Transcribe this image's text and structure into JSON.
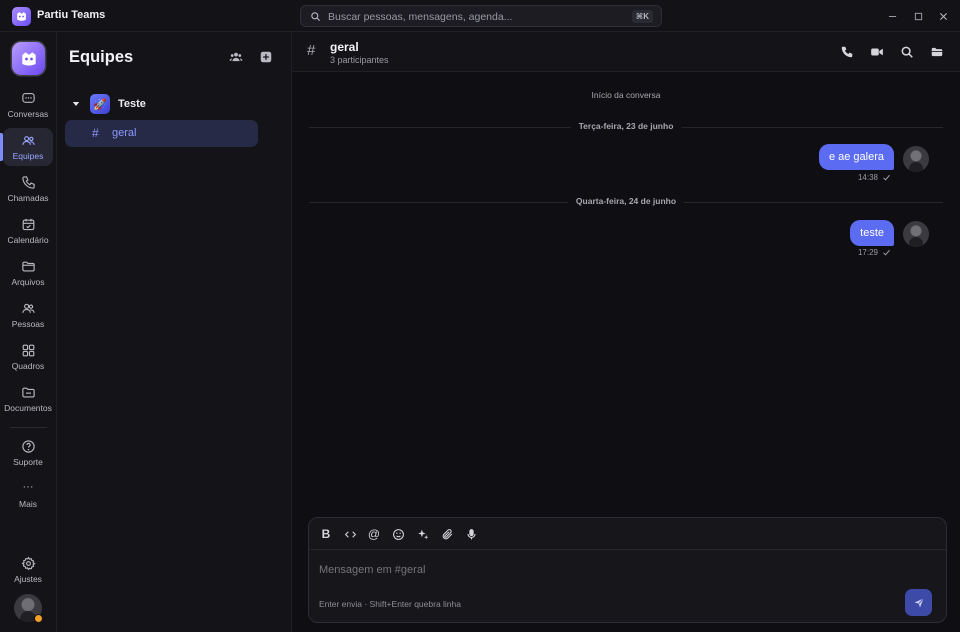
{
  "app": {
    "title": "Partiu Teams"
  },
  "search": {
    "placeholder": "Buscar pessoas, mensagens, agenda...",
    "shortcut": "⌘K"
  },
  "rail": {
    "items": [
      {
        "label": "Conversas",
        "icon": "chat-icon"
      },
      {
        "label": "Equipes",
        "icon": "team-icon",
        "active": true
      },
      {
        "label": "Chamadas",
        "icon": "phone-icon"
      },
      {
        "label": "Calendário",
        "icon": "calendar-icon"
      },
      {
        "label": "Arquivos",
        "icon": "folder-icon"
      },
      {
        "label": "Pessoas",
        "icon": "people-icon"
      },
      {
        "label": "Quadros",
        "icon": "grid-icon"
      },
      {
        "label": "Documentos",
        "icon": "document-folder-icon"
      }
    ],
    "support_label": "Suporte",
    "more_label": "Mais",
    "more_glyph": "···",
    "settings_label": "Ajustes",
    "status_color": "#f2a025"
  },
  "sidebar": {
    "title": "Equipes",
    "team": {
      "name": "Teste",
      "emoji": "🚀"
    },
    "channel": {
      "hash": "#",
      "name": "geral"
    }
  },
  "channel": {
    "hash": "#",
    "title": "geral",
    "subtitle": "3 participantes"
  },
  "conversation": {
    "start_label": "Início da conversa",
    "days": [
      {
        "label": "Terça-feira, 23 de junho",
        "message": {
          "text": "e ae galera",
          "time": "14:38"
        }
      },
      {
        "label": "Quarta-feira, 24 de junho",
        "message": {
          "text": "teste",
          "time": "17:29"
        }
      }
    ]
  },
  "composer": {
    "placeholder": "Mensagem em #geral",
    "hint": "Enter envia · Shift+Enter quebra linha",
    "bold_glyph": "B",
    "mention_glyph": "@"
  },
  "colors": {
    "accent": "#5b6cf3",
    "active_text": "#8d98ff",
    "background": "#0f0f13"
  }
}
